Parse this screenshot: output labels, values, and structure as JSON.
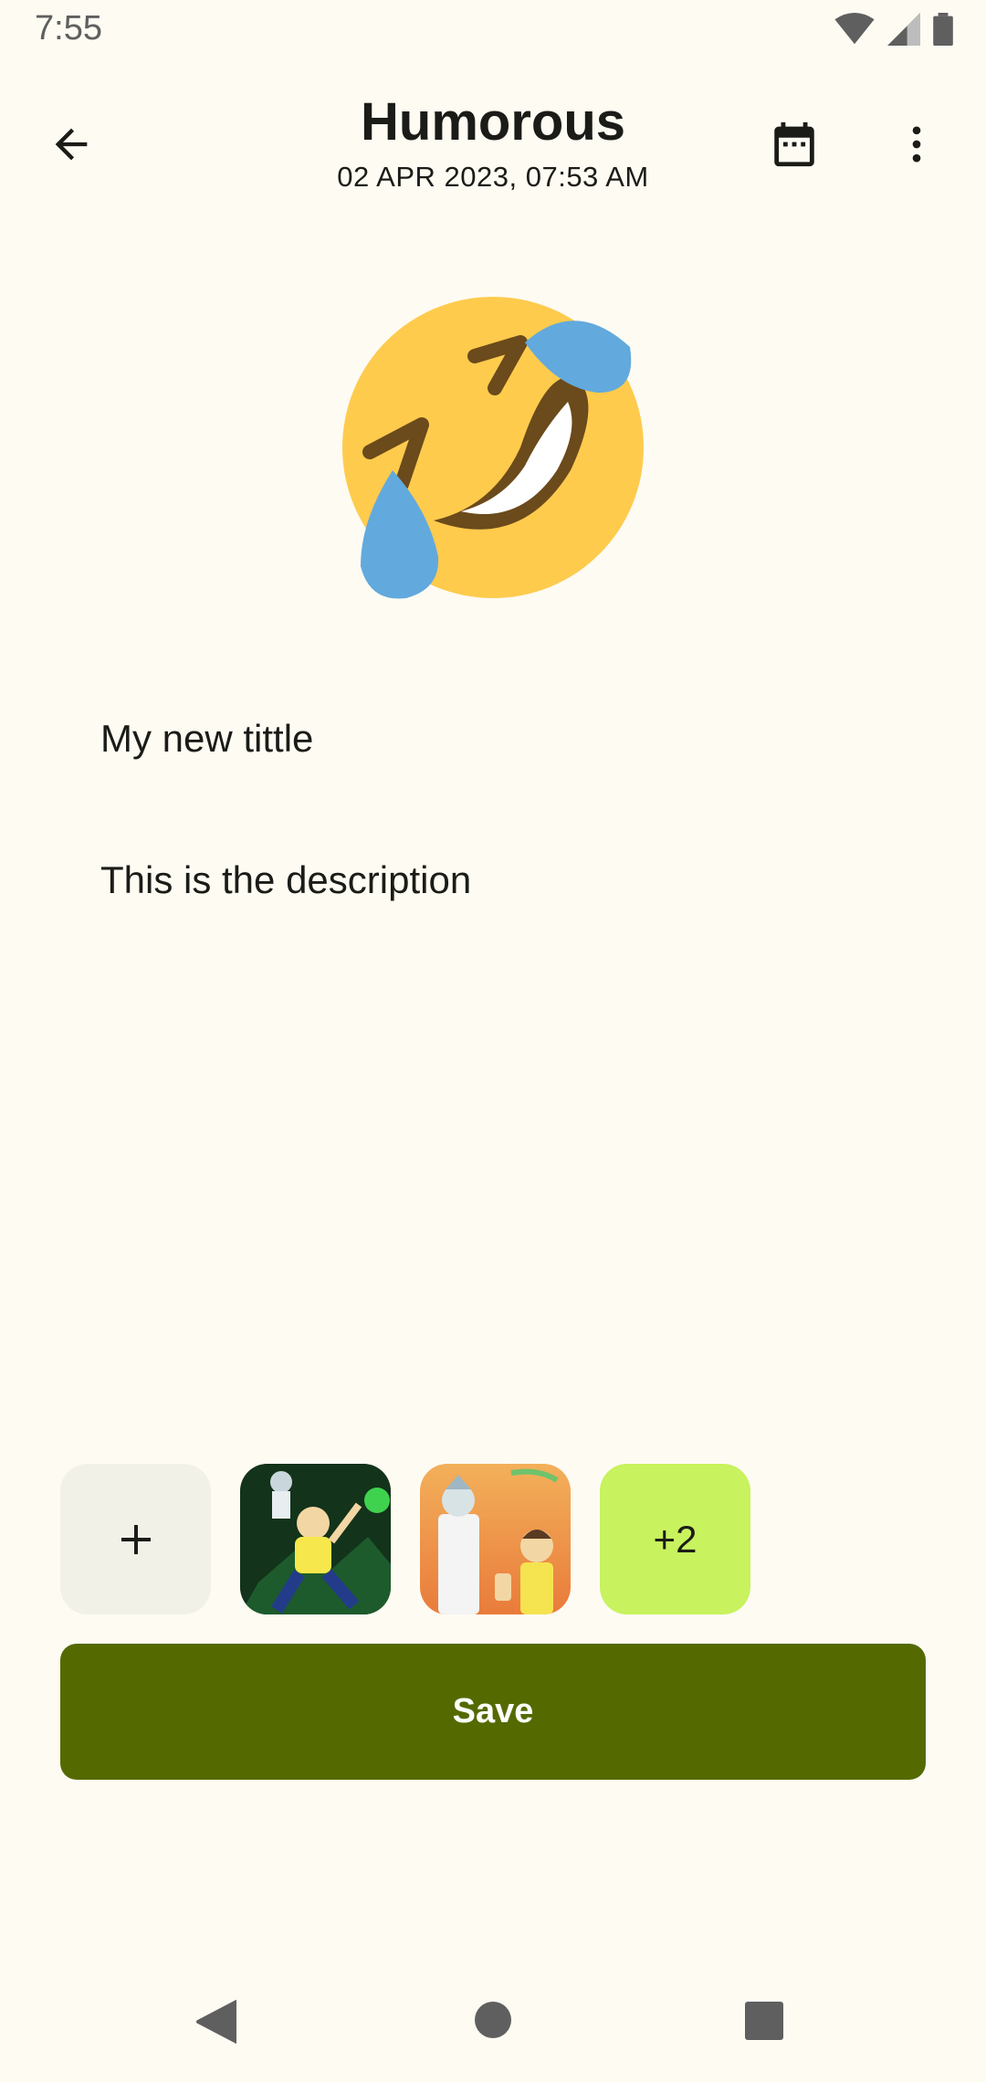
{
  "status_bar": {
    "time": "7:55"
  },
  "header": {
    "title": "Humorous",
    "subtitle": "02 APR 2023, 07:53 AM",
    "icons": [
      "back-arrow-icon",
      "calendar-icon",
      "more-vert-icon"
    ]
  },
  "mood": {
    "emoji": "rolling-on-floor-laughing-emoji"
  },
  "note": {
    "title_value": "My new tittle",
    "description_value": "This is the description"
  },
  "attachments": {
    "add_label": "+",
    "more_count": "+2",
    "items": [
      "rick-and-morty-image-1",
      "rick-and-morty-image-2"
    ]
  },
  "actions": {
    "save_label": "Save"
  },
  "colors": {
    "background": "#fefbf3",
    "primary": "#546a00",
    "more_tile": "#c8f25e",
    "add_tile": "#f2f1e8"
  }
}
